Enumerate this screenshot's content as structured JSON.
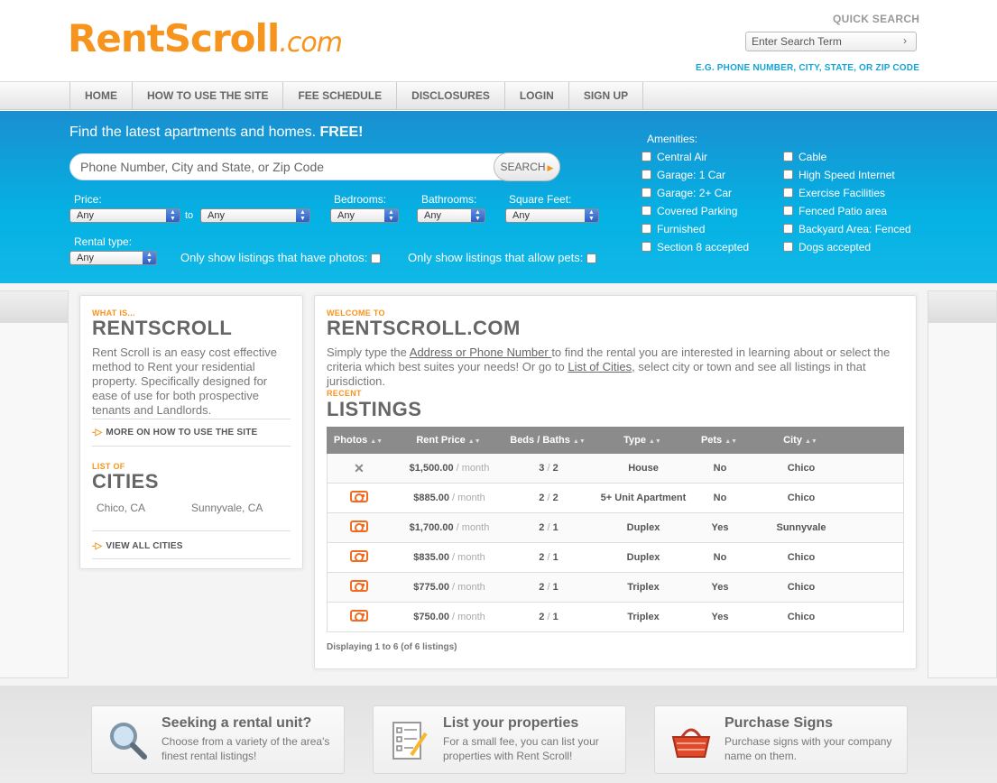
{
  "header": {
    "logo_main": "RentScroll",
    "logo_suffix": ".com",
    "quick_search_title": "QUICK SEARCH",
    "quick_search_placeholder": "Enter Search Term",
    "quick_search_arrow": "›",
    "quick_search_hint": "E.G. PHONE NUMBER, CITY, STATE, OR ZIP CODE"
  },
  "nav": {
    "items": [
      "HOME",
      "HOW TO USE THE SITE",
      "FEE SCHEDULE",
      "DISCLOSURES",
      "LOGIN",
      "SIGN UP"
    ]
  },
  "search": {
    "headline": "Find the latest apartments and homes.",
    "headline_bold": "FREE!",
    "placeholder": "Phone Number, City and State, or Zip Code",
    "button": "SEARCH",
    "price_label": "Price:",
    "to_label": "to",
    "bedrooms_label": "Bedrooms:",
    "bathrooms_label": "Bathrooms:",
    "sqft_label": "Square Feet:",
    "rental_type_label": "Rental type:",
    "any": "Any",
    "photos_only": "Only show listings that have photos:",
    "pets_only": "Only show listings that allow pets:"
  },
  "amenities": {
    "title": "Amenities:",
    "col1": [
      "Central Air",
      "Garage: 1 Car",
      "Garage: 2+ Car",
      "Covered Parking",
      "Furnished",
      "Section 8 accepted"
    ],
    "col2": [
      "Cable",
      "High Speed Internet",
      "Exercise Facilities",
      "Fenced Patio area",
      "Backyard Area: Fenced",
      "Dogs accepted"
    ]
  },
  "about": {
    "kicker": "WHAT IS...",
    "title": "RENTSCROLL",
    "text": "Rent Scroll is an easy cost effective method to Rent your residential property. Specifically designed for ease of use for both prospective tenants and Landlords.",
    "more": "MORE ON HOW TO USE THE SITE"
  },
  "cities": {
    "kicker": "LIST OF",
    "title": "CITIES",
    "items": [
      "Chico, CA",
      "Sunnyvale, CA"
    ],
    "view_all": "VIEW ALL CITIES"
  },
  "welcome": {
    "kicker": "WELCOME TO",
    "title": "RENTSCROLL.COM",
    "text1": "Simply type the ",
    "link1": "Address or Phone Number ",
    "text2": "to find the rental you are interested in learning about or select the criteria which best suites your needs!   Or go to ",
    "link2": "List of Cities",
    "text3": ", select city or town and see all listings in that jurisdiction."
  },
  "listings": {
    "kicker": "RECENT",
    "title": "LISTINGS",
    "columns": [
      "Photos",
      "Rent Price",
      "Beds / Baths",
      "Type",
      "Pets",
      "City"
    ],
    "per_month": " / month",
    "rows": [
      {
        "photo": false,
        "price": "$1,500.00",
        "beds": "3",
        "baths": "2",
        "type": "House",
        "pets": "No",
        "city": "Chico"
      },
      {
        "photo": true,
        "price": "$885.00",
        "beds": "2",
        "baths": "2",
        "type": "5+ Unit Apartment",
        "pets": "No",
        "city": "Chico"
      },
      {
        "photo": true,
        "price": "$1,700.00",
        "beds": "2",
        "baths": "1",
        "type": "Duplex",
        "pets": "Yes",
        "city": "Sunnyvale"
      },
      {
        "photo": true,
        "price": "$835.00",
        "beds": "2",
        "baths": "1",
        "type": "Duplex",
        "pets": "No",
        "city": "Chico"
      },
      {
        "photo": true,
        "price": "$775.00",
        "beds": "2",
        "baths": "1",
        "type": "Triplex",
        "pets": "Yes",
        "city": "Chico"
      },
      {
        "photo": true,
        "price": "$750.00",
        "beds": "2",
        "baths": "1",
        "type": "Triplex",
        "pets": "Yes",
        "city": "Chico"
      }
    ],
    "footer": "Displaying 1 to 6 (of 6 listings)"
  },
  "footer": {
    "boxes": [
      {
        "title": "Seeking a rental unit?",
        "text": "Choose from a variety of the area's finest rental listings!",
        "icon": "magnifier-icon"
      },
      {
        "title": "List your properties",
        "text": "For a small fee, you can list your properties with Rent Scroll!",
        "icon": "checklist-icon"
      },
      {
        "title": "Purchase Signs",
        "text": "Purchase signs with your company name on them.",
        "icon": "basket-icon"
      }
    ]
  },
  "colors": {
    "orange": "#f7941d",
    "blue": "#05b1e4",
    "header_gray": "#8b8b8b"
  }
}
